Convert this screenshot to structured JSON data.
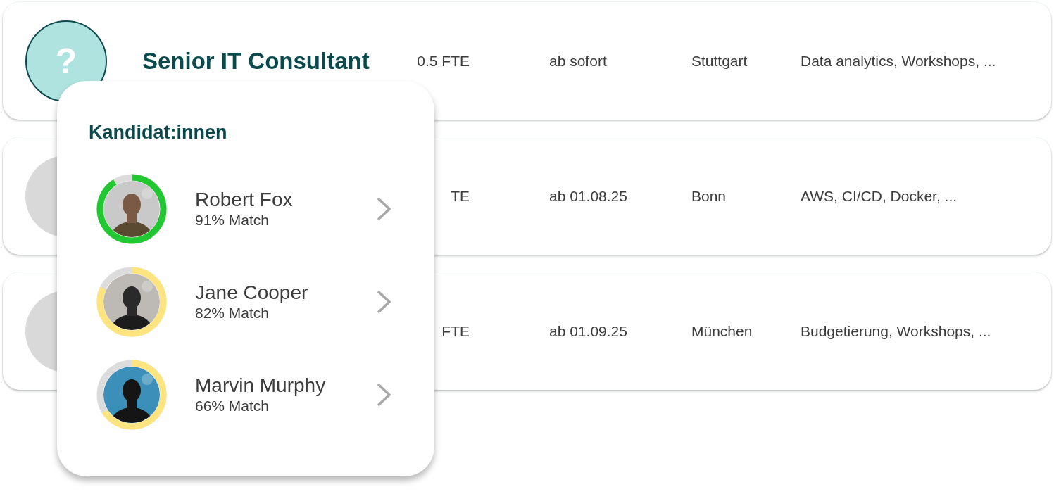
{
  "jobs": [
    {
      "avatar": {
        "kind": "unknown",
        "symbol": "?"
      },
      "title": "Senior IT Consultant",
      "fte": "0.5 FTE",
      "start": "ab sofort",
      "location": "Stuttgart",
      "skills": "Data analytics, Workshops, ..."
    },
    {
      "avatar": {
        "kind": "placeholder"
      },
      "fte": "TE",
      "start": "ab 01.08.25",
      "location": "Bonn",
      "skills": "AWS, CI/CD, Docker, ..."
    },
    {
      "avatar": {
        "kind": "placeholder"
      },
      "fte": "FTE",
      "start": "ab 01.09.25",
      "location": "München",
      "skills": "Budgetierung, Workshops, ..."
    }
  ],
  "candidates_popup": {
    "heading": "Kandidat:innen",
    "candidates": [
      {
        "name": "Robert Fox",
        "match": "91% Match",
        "level": 0.91,
        "color": "#22c832"
      },
      {
        "name": "Jane Cooper",
        "match": "82% Match",
        "level": 0.82,
        "color": "#fde47e"
      },
      {
        "name": "Marvin Murphy",
        "match": "66% Match",
        "level": 0.66,
        "color": "#fde47e"
      }
    ]
  }
}
